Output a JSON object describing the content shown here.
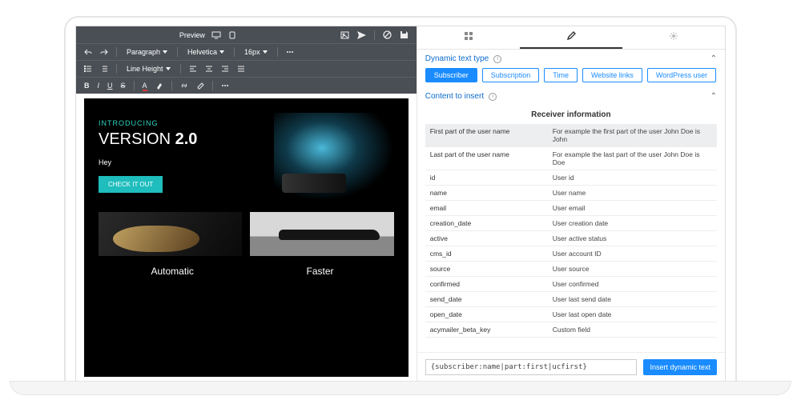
{
  "toolbar": {
    "preview_label": "Preview",
    "row2": {
      "para": "Paragraph",
      "font": "Helvetica",
      "size": "16px",
      "lh_label": "Line Height"
    }
  },
  "email": {
    "intro": "INTRODUCING",
    "title_a": "VERSION ",
    "title_b": "2.0",
    "hey": "Hey",
    "cta": "CHECK IT OUT",
    "cap1": "Automatic",
    "cap2": "Faster"
  },
  "side": {
    "section1": "Dynamic text type",
    "section2": "Content to insert",
    "chips": [
      "Subscriber",
      "Subscription",
      "Time",
      "Website links",
      "WordPress user"
    ],
    "panel_title": "Receiver information",
    "rows": [
      {
        "k": "First part of the user name",
        "v": "For example the first part of the user John Doe is John",
        "hl": true
      },
      {
        "k": "Last part of the user name",
        "v": "For example the last part of the user John Doe is Doe"
      },
      {
        "k": "id",
        "v": "User id"
      },
      {
        "k": "name",
        "v": "User name"
      },
      {
        "k": "email",
        "v": "User email"
      },
      {
        "k": "creation_date",
        "v": "User creation date"
      },
      {
        "k": "active",
        "v": "User active status"
      },
      {
        "k": "cms_id",
        "v": "User account ID"
      },
      {
        "k": "source",
        "v": "User source"
      },
      {
        "k": "confirmed",
        "v": "User confirmed"
      },
      {
        "k": "send_date",
        "v": "User last send date"
      },
      {
        "k": "open_date",
        "v": "User last open date"
      },
      {
        "k": "acymailer_beta_key",
        "v": "Custom field"
      }
    ],
    "code": "{subscriber:name|part:first|ucfirst}",
    "insert": "Insert dynamic text"
  }
}
